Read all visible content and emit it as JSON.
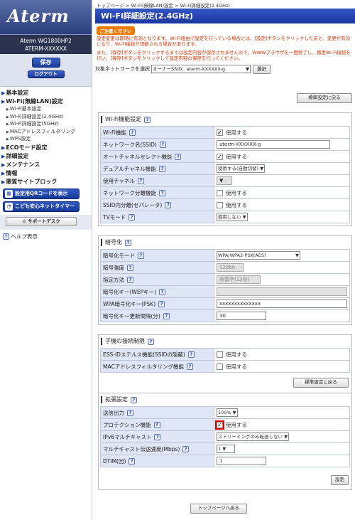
{
  "sidebar": {
    "logo": "Aterm",
    "model": "Aterm WG1800HP2",
    "device": "ATERM-XXXXXX",
    "save": "保存",
    "logout": "ログアウト",
    "nav": [
      {
        "label": "基本設定",
        "sub": []
      },
      {
        "label": "Wi-Fi(無線LAN)設定",
        "sub": [
          "Wi-Fi基本設定",
          "Wi-Fi詳細設定(2.4GHz)",
          "Wi-Fi詳細設定(5GHz)",
          "MACアドレスフィルタリング",
          "WPS設定"
        ]
      },
      {
        "label": "ECOモード設定",
        "sub": []
      },
      {
        "label": "詳細設定",
        "sub": []
      },
      {
        "label": "メンテナンス",
        "sub": []
      },
      {
        "label": "情報",
        "sub": []
      },
      {
        "label": "悪質サイトブロック",
        "sub": []
      }
    ],
    "qr_button": "設定用QRコードを表示",
    "kids_button": "こども安心ネットタイマー",
    "support": "サポートデスク",
    "help": "ヘルプ表示"
  },
  "main": {
    "breadcrumb": "トップページ > Wi-Fi(無線LAN)設定 > Wi-Fi詳細設定(2.4GHz)",
    "title": "Wi-Fi詳細設定(2.4GHz)",
    "caution_badge": "ご注意ください",
    "caution1": "設定変更は即時に有効となります。Wi-Fi経由で設定を行っている場合には、[設定]ボタンをクリックしたあと、変更が有効になり、Wi-Fi接続が切断される場合があります。",
    "caution2": "また、[保存]ボタンをクリックするまでは設定内容が保存されませんので、WWWブラウザを一度終了し、再度Wi-Fi接続を行い、[保存]ボタンをクリックして設定内容の保存を行ってください。",
    "target_label": "対象ネットワークを選択",
    "target_value": "オーナーSSID：aterm-XXXXXX-g",
    "select_button": "選択",
    "restore_default": "標準設定に戻る",
    "sections": {
      "wifi": {
        "title": "Wi-Fi機能設定",
        "rows": [
          {
            "label": "Wi-Fi機能",
            "value": "使用する"
          },
          {
            "label": "ネットワーク名(SSID)",
            "value": "aterm-XXXXXX-g"
          },
          {
            "label": "オートチャネルセレクト機能",
            "value": "使用する"
          },
          {
            "label": "デュアルチャネル機能",
            "value": "使用する(自動切替)"
          },
          {
            "label": "使用チャネル",
            "value": ""
          },
          {
            "label": "ネットワーク分離機能",
            "value": "使用する"
          },
          {
            "label": "SSID内分離(セパレータ)",
            "value": "使用する"
          },
          {
            "label": "TVモード",
            "value": "使用しない"
          }
        ]
      },
      "enc": {
        "title": "暗号化",
        "rows": [
          {
            "label": "暗号化モード",
            "value": "WPA/WPA2-PSK(AES)"
          },
          {
            "label": "暗号強度",
            "value": "128bit"
          },
          {
            "label": "指定方法",
            "value": "英数字(13桁)"
          },
          {
            "label": "暗号化キー(WEPキー)",
            "value": ""
          },
          {
            "label": "WPA暗号化キー(PSK)",
            "value": "xxxxxxxxxxxxxx"
          },
          {
            "label": "暗号化キー更新間隔(分)",
            "value": "30"
          }
        ]
      },
      "child": {
        "title": "子機の接続制限",
        "rows": [
          {
            "label": "ESS-IDステルス機能(SSIDの隠蔽)",
            "value": "使用する"
          },
          {
            "label": "MACアドレスフィルタリング機能",
            "value": "使用する"
          }
        ]
      },
      "ext": {
        "title": "拡張設定",
        "rows": [
          {
            "label": "送信出力",
            "value": "100%"
          },
          {
            "label": "プロテクション機能",
            "value": "使用する"
          },
          {
            "label": "IPv6マルチキャスト",
            "value": "ストリーミングのみ転送しない"
          },
          {
            "label": "マルチキャスト伝送速度(Mbps)",
            "value": "1"
          },
          {
            "label": "DTIM(回)",
            "value": "1"
          }
        ]
      }
    },
    "apply": "設定",
    "top_page": "トップページへ戻る"
  }
}
